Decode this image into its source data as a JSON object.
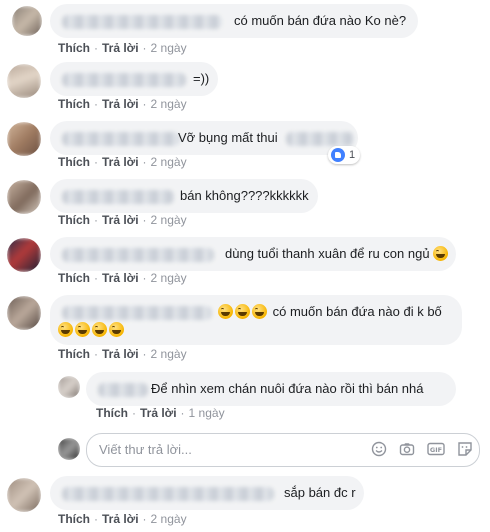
{
  "labels": {
    "like": "Thích",
    "reply": "Trả lời",
    "sep": "·"
  },
  "comments": [
    {
      "text": "có muốn bán đứa nào Ko nè?",
      "time": "2 ngày"
    },
    {
      "text": "=))",
      "time": "2 ngày"
    },
    {
      "text": "Vỡ bụng mất thui",
      "time": "2 ngày",
      "like_count": "1"
    },
    {
      "text": "bán không????kkkkkk",
      "time": "2 ngày"
    },
    {
      "text": "dùng tuổi thanh xuân để ru con ngủ",
      "time": "2 ngày"
    },
    {
      "text": "có muốn bán đứa nào đi k bố",
      "time": "2 ngày"
    },
    {
      "text": "Để nhìn xem chán nuôi đứa nào rồi thì bán nhá",
      "time": "1 ngày"
    },
    {
      "text": "sắp bán đc r",
      "time": "2 ngày"
    }
  ],
  "reply_box": {
    "placeholder": "Viết thư trả lời..."
  },
  "icons": [
    "emoji-icon",
    "camera-icon",
    "gif-icon",
    "sticker-icon"
  ],
  "colors": {
    "bubble": "#f2f3f5",
    "link": "#4b4f56",
    "like_blue": "#4080ff"
  }
}
